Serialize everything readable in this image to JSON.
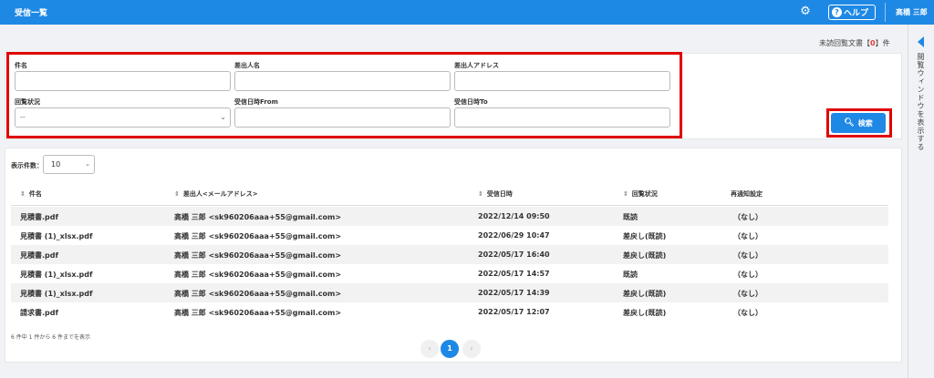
{
  "header": {
    "title": "受信一覧",
    "help_label": "ヘルプ",
    "user_name": "高橋 三郎"
  },
  "unread": {
    "prefix": "未読回覧文書【",
    "count": "0",
    "suffix": "】件"
  },
  "side_panel": {
    "label": "閲覧ウィンドウを表示する"
  },
  "search": {
    "subject_label": "件名",
    "subject_value": "",
    "sender_name_label": "差出人名",
    "sender_name_value": "",
    "sender_address_label": "差出人アドレス",
    "sender_address_value": "",
    "status_label": "回覧状況",
    "status_value": "--",
    "date_from_label": "受信日時From",
    "date_from_value": "",
    "date_to_label": "受信日時To",
    "date_to_value": "",
    "search_button": "検索"
  },
  "results": {
    "per_page_label": "表示件数：",
    "per_page_value": "10",
    "columns": {
      "subject": "件名",
      "sender": "差出人<メールアドレス>",
      "received": "受信日時",
      "status": "回覧状況",
      "renotify": "再通知設定"
    },
    "rows": [
      {
        "subject": "見積書.pdf",
        "sender": "高橋 三郎 <sk960206aaa+55@gmail.com>",
        "received": "2022/12/14 09:50",
        "status": "既読",
        "renotify": "（なし）"
      },
      {
        "subject": "見積書 (1)_xlsx.pdf",
        "sender": "高橋 三郎 <sk960206aaa+55@gmail.com>",
        "received": "2022/06/29 10:47",
        "status": "差戻し(既読)",
        "renotify": "（なし）"
      },
      {
        "subject": "見積書.pdf",
        "sender": "高橋 三郎 <sk960206aaa+55@gmail.com>",
        "received": "2022/05/17 16:40",
        "status": "差戻し(既読)",
        "renotify": "（なし）"
      },
      {
        "subject": "見積書 (1)_xlsx.pdf",
        "sender": "高橋 三郎 <sk960206aaa+55@gmail.com>",
        "received": "2022/05/17 14:57",
        "status": "既読",
        "renotify": "（なし）"
      },
      {
        "subject": "見積書 (1)_xlsx.pdf",
        "sender": "高橋 三郎 <sk960206aaa+55@gmail.com>",
        "received": "2022/05/17 14:39",
        "status": "差戻し(既読)",
        "renotify": "（なし）"
      },
      {
        "subject": "請求書.pdf",
        "sender": "高橋 三郎 <sk960206aaa+55@gmail.com>",
        "received": "2022/05/17 12:07",
        "status": "差戻し(既読)",
        "renotify": "（なし）"
      }
    ],
    "summary": "6 件中 1 件から 6 件までを表示",
    "pagination": {
      "prev": "‹",
      "current": "1",
      "next": "›"
    }
  },
  "colors": {
    "primary": "#1e88e5",
    "highlight": "#e00000",
    "unread_count": "#e53935"
  }
}
